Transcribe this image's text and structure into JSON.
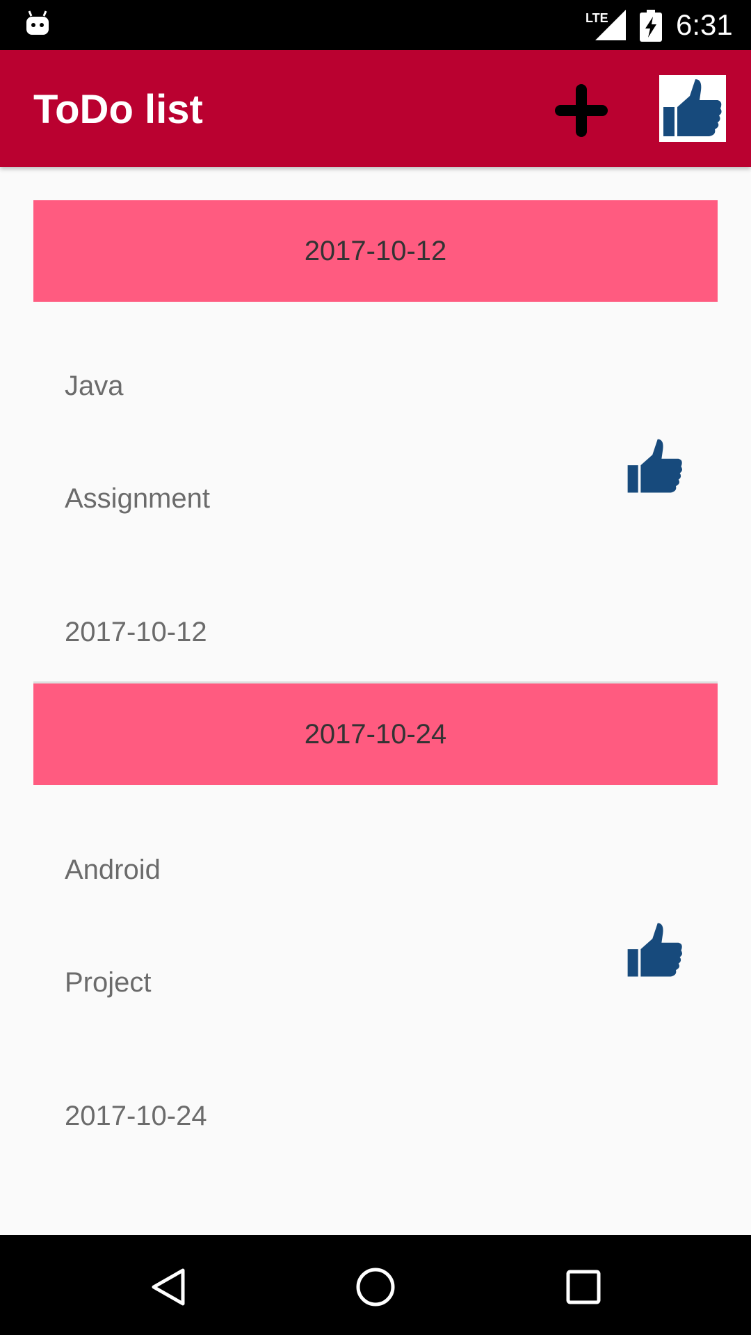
{
  "status_bar": {
    "network": "LTE",
    "time": "6:31",
    "icons": [
      "android-notification-icon",
      "lte-signal-icon",
      "battery-charging-icon"
    ]
  },
  "app_bar": {
    "title": "ToDo list",
    "actions": [
      "plus-icon",
      "thumbs-up-icon"
    ],
    "color": "#ba0130"
  },
  "sections": [
    {
      "date_header": "2017-10-12",
      "item": {
        "title": "Java",
        "description": "Assignment",
        "date": "2017-10-12",
        "icon": "thumbs-up-icon"
      }
    },
    {
      "date_header": "2017-10-24",
      "item": {
        "title": "Android",
        "description": "Project",
        "date": "2017-10-24",
        "icon": "thumbs-up-icon"
      }
    }
  ],
  "nav_bar": {
    "buttons": [
      "back-icon",
      "home-icon",
      "recents-icon"
    ]
  },
  "colors": {
    "header_band": "#ff5b80",
    "icon_blue": "#174a7c"
  }
}
